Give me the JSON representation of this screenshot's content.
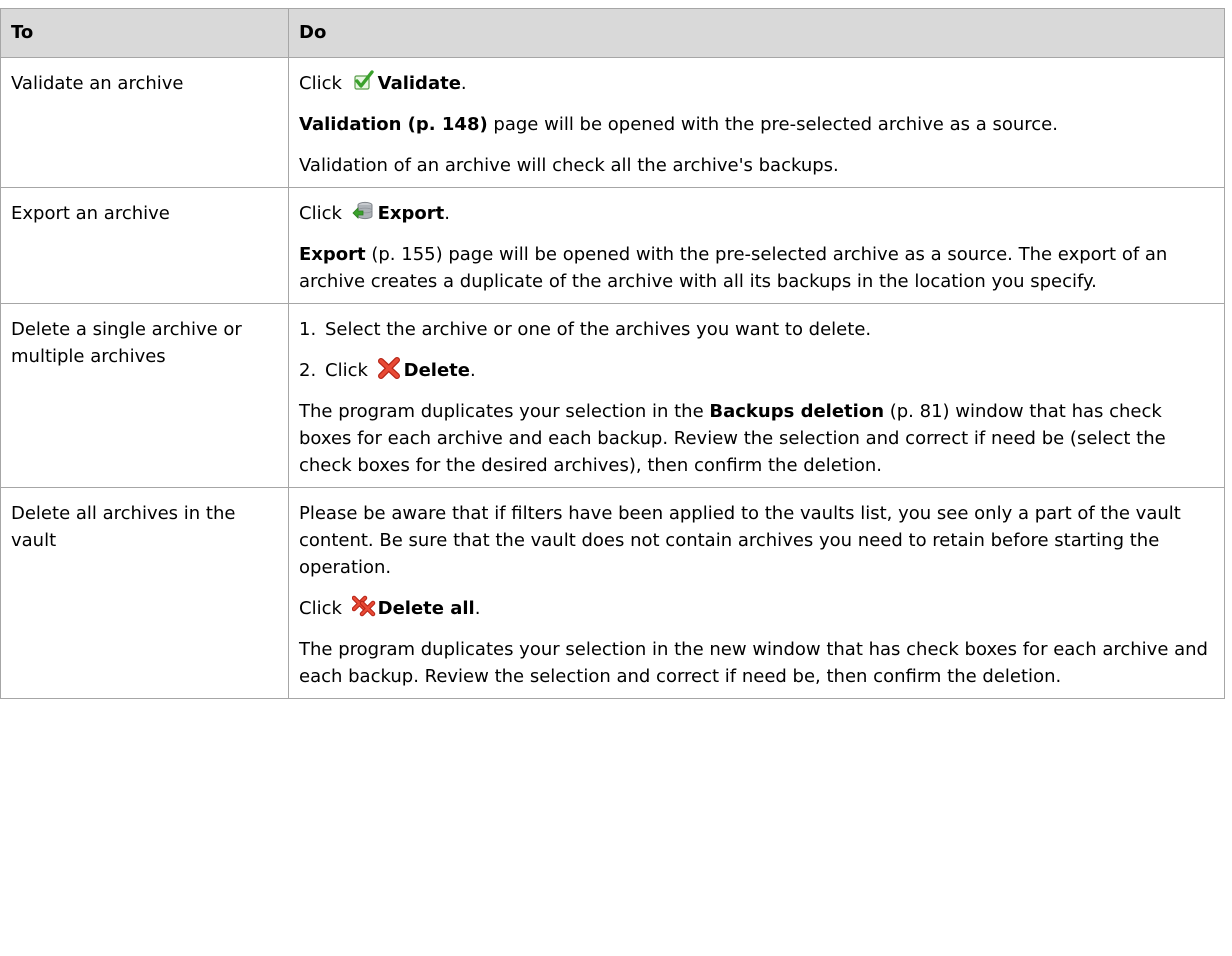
{
  "header": {
    "col_to": "To",
    "col_do": "Do"
  },
  "rows": [
    {
      "to": "Validate an archive",
      "click": "Click",
      "action": "Validate",
      "period": ".",
      "p2_bold": "Validation (p. 148)",
      "p2_rest": " page will be opened with the pre-selected archive as a source.",
      "p3": "Validation of an archive will check all the archive's backups."
    },
    {
      "to": "Export an archive",
      "click": "Click",
      "action": "Export",
      "period": ".",
      "p2_bold": "Export",
      "p2_rest": " (p. 155) page will be opened with the pre-selected archive as a source. The export of an archive creates a duplicate of the archive with all its backups in the location you specify."
    },
    {
      "to": "Delete a single archive or multiple archives",
      "step1_num": "1.",
      "step1": "Select the archive or one of the archives you want to delete.",
      "step2_num": "2.",
      "click": "Click",
      "action": "Delete",
      "period": ".",
      "p3_pre": "The program duplicates your selection in the ",
      "p3_bold": "Backups deletion",
      "p3_rest": " (p. 81) window that has check boxes for each archive and each backup. Review the selection and correct if need be (select the check boxes for the desired archives), then confirm the deletion."
    },
    {
      "to": "Delete all archives in the vault",
      "p1": "Please be aware that if filters have been applied to the vaults list, you see only a part of the vault content. Be sure that the vault does not contain archives you need to retain before starting the operation.",
      "click": "Click",
      "action": "Delete all",
      "period": ".",
      "p3": "The program duplicates your selection in the new window that has check boxes for each archive and each backup. Review the selection and correct if need be, then confirm the deletion."
    }
  ],
  "icons": {
    "validate": "validate-check-icon",
    "export": "export-database-icon",
    "delete": "delete-x-icon",
    "delete_all": "delete-all-x-icon"
  },
  "colors": {
    "header_bg": "#d9d9d9",
    "border": "#a6a6a6",
    "check_green": "#3aa12c",
    "delete_red": "#e03020"
  }
}
